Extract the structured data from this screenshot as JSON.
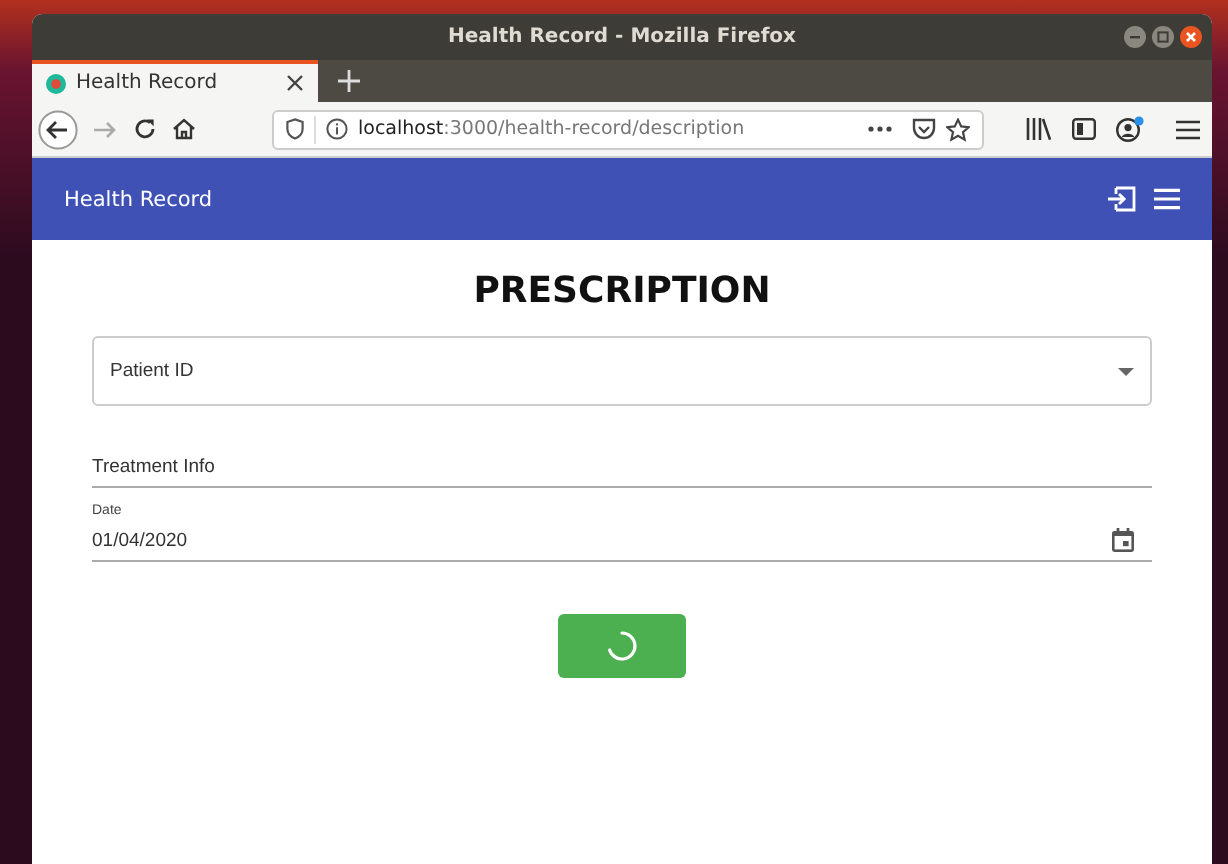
{
  "window": {
    "title": "Health Record - Mozilla Firefox"
  },
  "tabs": [
    {
      "label": "Health Record",
      "selected": true
    }
  ],
  "address_bar": {
    "url": "**localhost**:3000/health-record/description"
  },
  "app_bar": {
    "title": "Health Record"
  },
  "form": {
    "heading": "PRESCRIPTION",
    "fields": [
      {
        "kind": "select",
        "placeholder": "Patient ID"
      },
      {
        "kind": "text",
        "placeholder": "Treatment Info"
      },
      {
        "kind": "date",
        "label": "Date",
        "value": "01/04/2020"
      }
    ],
    "submit": {
      "loading": true
    }
  }
}
